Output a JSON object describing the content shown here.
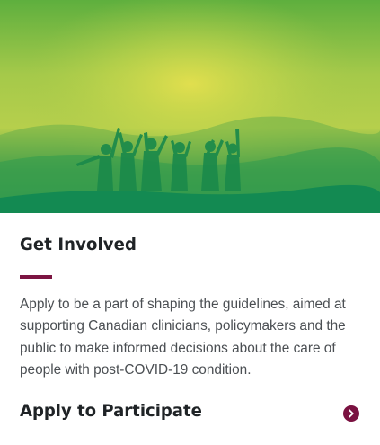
{
  "hero": {
    "image": "people-silhouettes-celebrating-at-sunset",
    "colors": {
      "top": "#6fb43f",
      "glow": "#d7dc4e",
      "bottom": "#168a52"
    }
  },
  "card": {
    "title": "Get Involved",
    "description": "Apply to be a part of shaping the guidelines, aimed at supporting Canadian clinicians, policymakers and the public to make informed decisions about the care of people with post-COVID-19 condition.",
    "cta_label": "Apply to Participate",
    "cta_icon": "chevron-right-icon"
  },
  "colors": {
    "accent": "#7a1140",
    "heading": "#1f2326",
    "body_text": "#4b4f53"
  }
}
